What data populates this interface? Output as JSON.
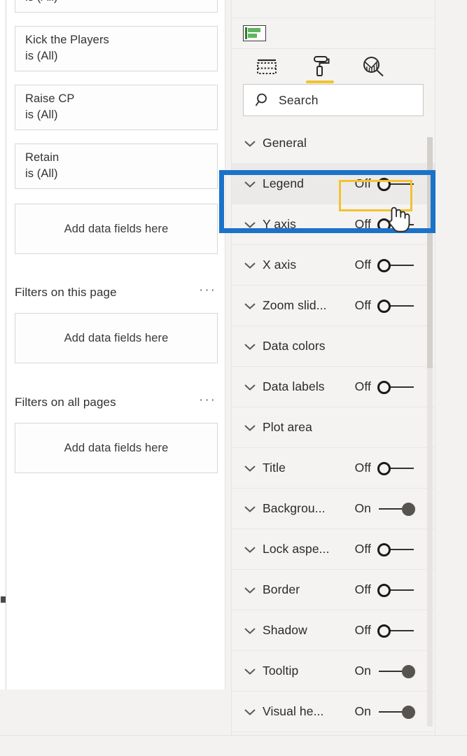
{
  "filters_pane": {
    "filter_cards": [
      {
        "name": "",
        "value": "is (All)",
        "partial_top": true
      },
      {
        "name": "Kick the Players",
        "value": "is (All)"
      },
      {
        "name": "Raise CP",
        "value": "is (All)"
      },
      {
        "name": "Retain",
        "value": "is (All)"
      }
    ],
    "visual_dropzone_label": "Add data fields here",
    "sections": [
      {
        "title": "Filters on this page",
        "menu": "···",
        "dropzone": "Add data fields here"
      },
      {
        "title": "Filters on all pages",
        "menu": "···",
        "dropzone": "Add data fields here"
      }
    ]
  },
  "format_pane": {
    "visual_type_icon": "bar-chart-visual-icon",
    "tabs": [
      {
        "id": "fields",
        "icon": "fields-table-icon",
        "active": false
      },
      {
        "id": "format",
        "icon": "paint-roller-icon",
        "active": true
      },
      {
        "id": "analytics",
        "icon": "analytics-magnifier-icon",
        "active": false
      }
    ],
    "search": {
      "placeholder": "Search",
      "value": "",
      "icon": "search-icon"
    },
    "properties": [
      {
        "label": "General",
        "toggle": null
      },
      {
        "label": "Legend",
        "toggle": "Off",
        "highlighted": true,
        "focused": true
      },
      {
        "label": "Y axis",
        "toggle": "Off"
      },
      {
        "label": "X axis",
        "toggle": "Off"
      },
      {
        "label": "Zoom slid...",
        "toggle": "Off"
      },
      {
        "label": "Data colors",
        "toggle": null
      },
      {
        "label": "Data labels",
        "toggle": "Off"
      },
      {
        "label": "Plot area",
        "toggle": null
      },
      {
        "label": "Title",
        "toggle": "Off"
      },
      {
        "label": "Backgrou...",
        "toggle": "On"
      },
      {
        "label": "Lock aspe...",
        "toggle": "Off"
      },
      {
        "label": "Border",
        "toggle": "Off"
      },
      {
        "label": "Shadow",
        "toggle": "Off"
      },
      {
        "label": "Tooltip",
        "toggle": "On"
      },
      {
        "label": "Visual he...",
        "toggle": "On"
      }
    ]
  },
  "annotations": {
    "highlight_color": "#1b72c9",
    "focus_color": "#f2c230",
    "cursor": "hand-pointer-cursor"
  }
}
